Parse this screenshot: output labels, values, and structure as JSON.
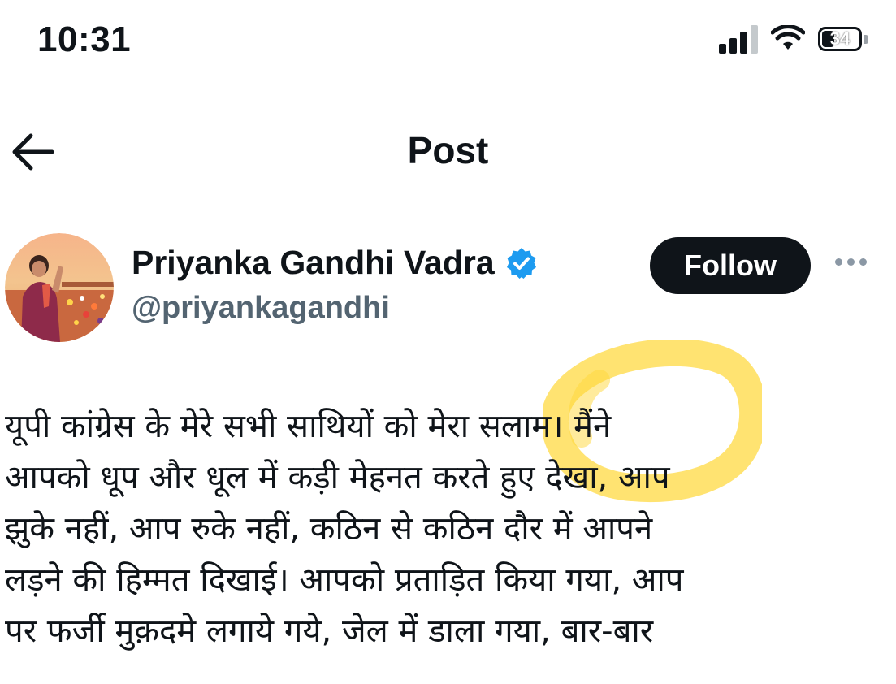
{
  "status_bar": {
    "time": "10:31",
    "battery": "34",
    "icons": [
      "signal-icon",
      "wifi-icon",
      "battery-icon"
    ]
  },
  "header": {
    "title": "Post",
    "back_icon": "arrow-left-icon"
  },
  "author": {
    "display_name": "Priyanka Gandhi Vadra",
    "handle": "@priyankagandhi",
    "verified": true,
    "verified_color": "#1d9bf0"
  },
  "follow_label": "Follow",
  "more_icon": "ellipsis-icon",
  "post": {
    "text": "यूपी कांग्रेस के मेरे सभी साथियों को मेरा सलाम। मैंने\nआपको धूप और धूल में कड़ी मेहनत करते हुए देखा, आप\nझुके नहीं, आप रुके नहीं, कठिन से कठिन दौर में आपने\nलड़ने की हिम्मत दिखाई। आपको प्रताड़ित किया गया, आप\nपर फर्जी मुक़दमे लगाये गये, जेल में डाला गया, बार-बार"
  },
  "colors": {
    "text_primary": "#0f1419",
    "text_secondary": "#536471",
    "highlight": "#ffd83a"
  }
}
